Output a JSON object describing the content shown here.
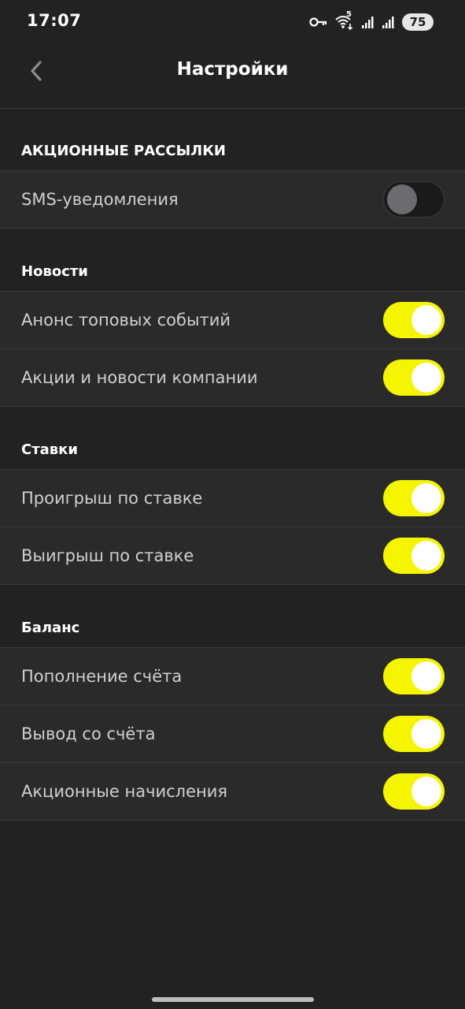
{
  "status_bar": {
    "time": "17:07",
    "network_label": "5",
    "battery": "75",
    "icons": [
      "key-icon",
      "wifi-icon",
      "signal-icon",
      "signal-icon",
      "battery-icon"
    ]
  },
  "header": {
    "title": "Настройки",
    "back_icon": "chevron-left-icon"
  },
  "colors": {
    "background": "#222222",
    "row_background": "#2a2a2a",
    "toggle_on": "#f5f500",
    "toggle_off": "#1a1a1a",
    "label_text": "#d0d0d0"
  },
  "sections": [
    {
      "title": "АКЦИОННЫЕ РАССЫЛКИ",
      "items": [
        {
          "label": "SMS-уведомления",
          "enabled": false
        }
      ]
    },
    {
      "title": "Новости",
      "items": [
        {
          "label": "Анонс топовых событий",
          "enabled": true
        },
        {
          "label": "Акции и новости компании",
          "enabled": true
        }
      ]
    },
    {
      "title": "Ставки",
      "items": [
        {
          "label": "Проигрыш по ставке",
          "enabled": true
        },
        {
          "label": "Выигрыш по ставке",
          "enabled": true
        }
      ]
    },
    {
      "title": "Баланс",
      "items": [
        {
          "label": "Пополнение счёта",
          "enabled": true
        },
        {
          "label": "Вывод со счёта",
          "enabled": true
        },
        {
          "label": "Акционные начисления",
          "enabled": true
        }
      ]
    }
  ]
}
